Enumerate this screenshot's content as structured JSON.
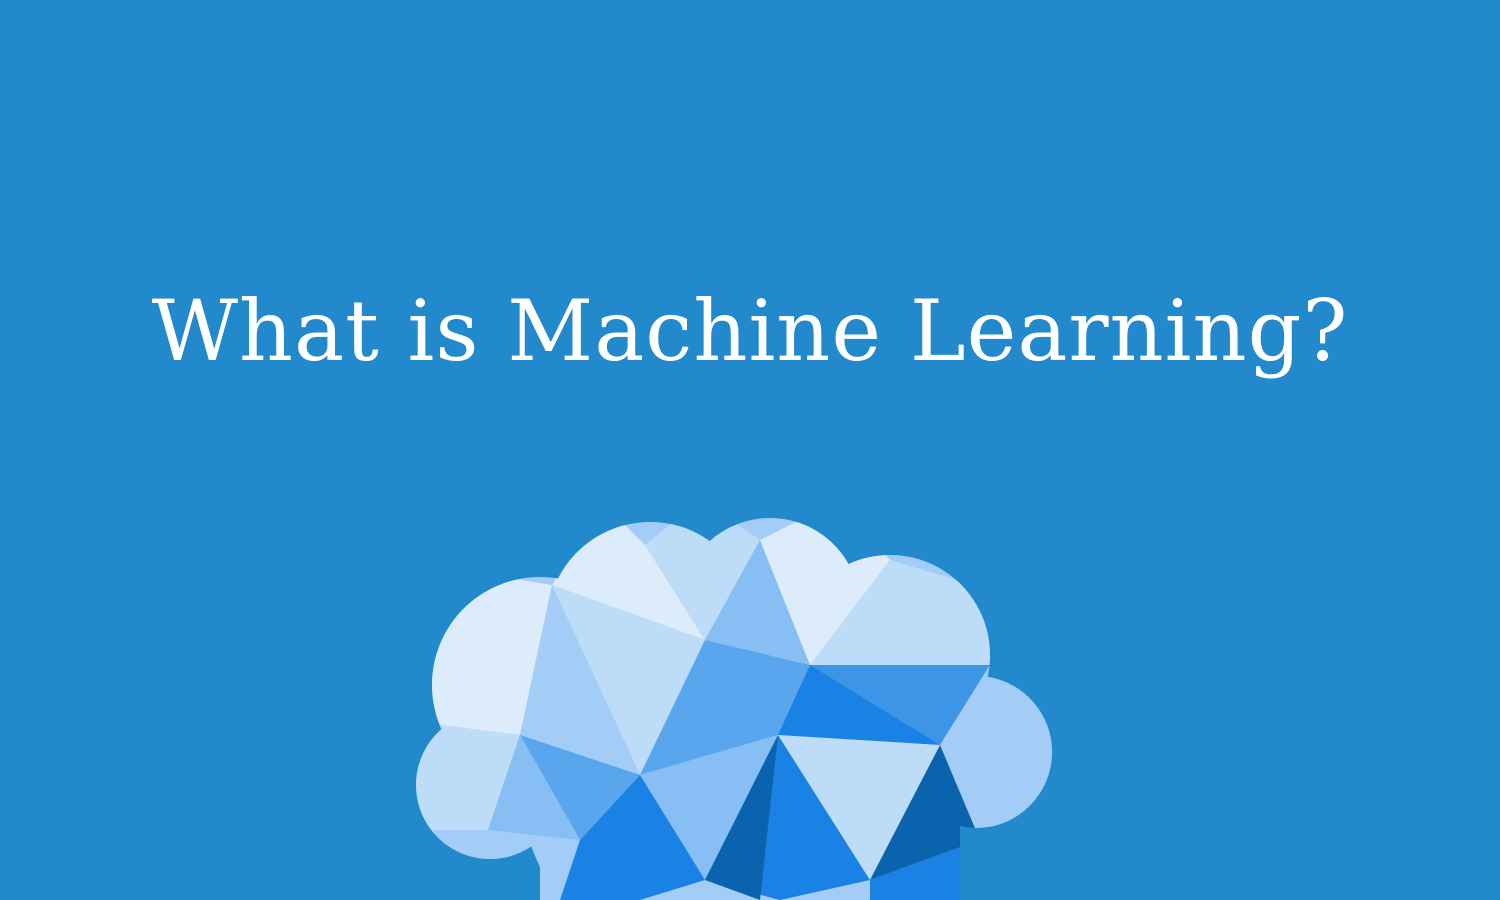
{
  "page": {
    "background_color": "#2289cc",
    "headline": "What is Machine Learning?"
  },
  "illustration": {
    "icon": "low-poly-brain-icon",
    "palette": [
      "#ddecfb",
      "#bcdcf8",
      "#a3cdf6",
      "#87bff4",
      "#5aa6ee",
      "#3d95e8",
      "#1a82e4",
      "#0b62ad"
    ]
  }
}
